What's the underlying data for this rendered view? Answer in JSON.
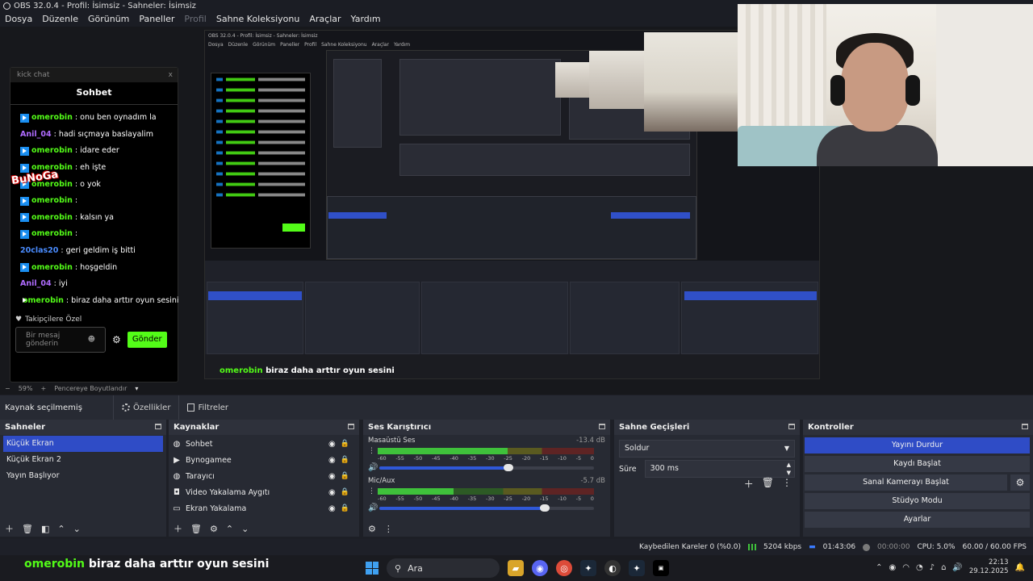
{
  "window": {
    "title": "OBS 32.0.4 - Profil: İsimsiz - Sahneler: İsimsiz"
  },
  "menu": [
    "Dosya",
    "Düzenle",
    "Görünüm",
    "Paneller",
    "Profil",
    "Sahne Koleksiyonu",
    "Araçlar",
    "Yardım"
  ],
  "chat": {
    "tab": "kick chat",
    "close": "x",
    "title": "Sohbet",
    "messages": [
      {
        "user": "omerobin",
        "text": ": onu ben oynadım la",
        "color": "#53fc18",
        "badge": true
      },
      {
        "user": "Anil_04",
        "text": ": hadi sıçmaya baslayalim",
        "color": "#b06cff",
        "badge": false
      },
      {
        "user": "omerobin",
        "text": ": idare eder",
        "color": "#53fc18",
        "badge": true
      },
      {
        "user": "omerobin",
        "text": ": eh işte",
        "color": "#53fc18",
        "badge": true
      },
      {
        "user": "omerobin",
        "text": ": o yok",
        "color": "#53fc18",
        "badge": true
      },
      {
        "user": "omerobin",
        "text": ":",
        "color": "#53fc18",
        "badge": true
      },
      {
        "user": "omerobin",
        "text": ": kalsın ya",
        "color": "#53fc18",
        "badge": true
      },
      {
        "user": "omerobin",
        "text": ":",
        "color": "#53fc18",
        "badge": true
      },
      {
        "user": "20clas20",
        "text": ": geri geldim iş bitti",
        "color": "#4a8cff",
        "badge": false
      },
      {
        "user": "omerobin",
        "text": ": hoşgeldin",
        "color": "#53fc18",
        "badge": true
      },
      {
        "user": "Anil_04",
        "text": ": iyi",
        "color": "#b06cff",
        "badge": false
      },
      {
        "user": "omerobin",
        "text": ": biraz daha arttır oyun sesini",
        "color": "#53fc18",
        "badge": true
      }
    ],
    "pinned": "Takipçilere Özel",
    "input_placeholder": "Bir mesaj gönderin",
    "send": "Gönder",
    "overlay_text": "BuNoGa"
  },
  "preview": {
    "zoom": "59%",
    "resize_label": "Pencereye Boyutlandır",
    "inner_caption_user": "omerobin",
    "inner_caption_text": "biraz daha arttır oyun sesini"
  },
  "source_toolbar": {
    "none_selected": "Kaynak seçilmemiş",
    "properties": "Özellikler",
    "filters": "Filtreler"
  },
  "scenes": {
    "title": "Sahneler",
    "items": [
      "Küçük Ekran",
      "Küçük Ekran 2",
      "Yayın Başlıyor"
    ],
    "selected": 0
  },
  "sources": {
    "title": "Kaynaklar",
    "items": [
      {
        "name": "Sohbet",
        "icon": "globe-icon"
      },
      {
        "name": "Bynogamee",
        "icon": "play-icon"
      },
      {
        "name": "Tarayıcı",
        "icon": "globe-icon"
      },
      {
        "name": "Video Yakalama Aygıtı",
        "icon": "camera-icon"
      },
      {
        "name": "Ekran Yakalama",
        "icon": "monitor-icon"
      }
    ]
  },
  "mixer": {
    "title": "Ses Karıştırıcı",
    "channels": [
      {
        "name": "Masaüstü Ses",
        "db": "-13.4 dB",
        "level": 0.6,
        "fader": 0.6
      },
      {
        "name": "Mic/Aux",
        "db": "-5.7 dB",
        "level": 0.35,
        "fader": 0.77
      }
    ],
    "ticks": [
      "-60",
      "-55",
      "-50",
      "-45",
      "-40",
      "-35",
      "-30",
      "-25",
      "-20",
      "-15",
      "-10",
      "-5",
      "0"
    ]
  },
  "transitions": {
    "title": "Sahne Geçişleri",
    "selected": "Soldur",
    "duration_label": "Süre",
    "duration_value": "300 ms"
  },
  "controls": {
    "title": "Kontroller",
    "stop_stream": "Yayını Durdur",
    "start_record": "Kaydı Başlat",
    "virtual_cam": "Sanal Kamerayı Başlat",
    "studio_mode": "Stüdyo Modu",
    "settings": "Ayarlar"
  },
  "status": {
    "dropped": "Kaybedilen Kareler 0 (%0.0)",
    "bitrate": "5204 kbps",
    "stream_time": "01:43:06",
    "rec_time": "00:00:00",
    "cpu": "CPU: 5.0%",
    "fps": "60.00 / 60.00 FPS"
  },
  "overlay_caption": {
    "user": "omerobin",
    "text": "biraz daha arttır oyun sesini"
  },
  "taskbar": {
    "search": "Ara",
    "time": "22:13",
    "date": "29.12.2025"
  },
  "colors": {
    "accent": "#2f4cc6",
    "kick_green": "#53fc18",
    "dock_bg": "#272a33"
  }
}
